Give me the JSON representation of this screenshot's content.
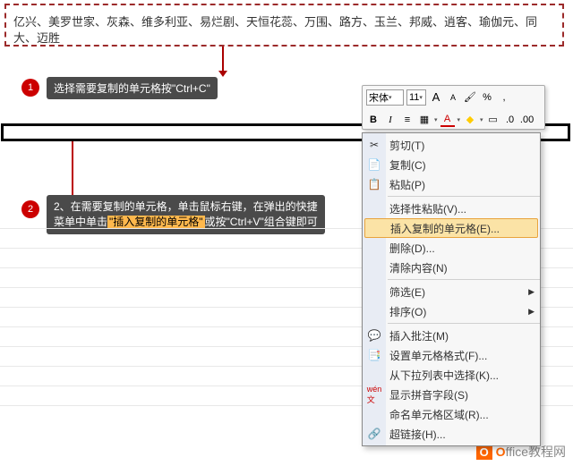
{
  "topBoxText": "亿兴、美罗世家、灰森、维多利亚、易烂剧、天恒花蕊、万围、路方、玉兰、邦威、逍客、瑜伽元、同大、迈胜",
  "step1": {
    "num": "1",
    "text": "选择需要复制的单元格按\"Ctrl+C\""
  },
  "step2": {
    "num": "2",
    "text_a": "2、在需要复制的单元格，单击鼠标右键，在弹出的快捷",
    "text_b": "菜单中单击",
    "hl": "\"插入复制的单元格\"",
    "text_c": "或按\"Ctrl+V\"组合键即可"
  },
  "miniToolbar": {
    "font": "宋体",
    "size": "11",
    "icons": {
      "growFont": "A",
      "shrinkFont": "A",
      "format": "🖌",
      "percent": "%",
      "bold": "B",
      "italic": "I",
      "align": "≡",
      "borders": "▦",
      "fontColor": "A",
      "fillColor": "◆",
      "decimals": "₀₀"
    }
  },
  "ctx": {
    "cut": "剪切(T)",
    "copy": "复制(C)",
    "paste": "粘贴(P)",
    "pasteSpecial": "选择性粘贴(V)...",
    "insertCopied": "插入复制的单元格(E)...",
    "delete": "删除(D)...",
    "clear": "清除内容(N)",
    "filter": "筛选(E)",
    "sort": "排序(O)",
    "insertComment": "插入批注(M)",
    "formatCells": "设置单元格格式(F)...",
    "pickList": "从下拉列表中选择(K)...",
    "pinyin": "显示拼音字段(S)",
    "nameRange": "命名单元格区域(R)...",
    "hyperlink": "超链接(H)..."
  },
  "watermark": {
    "brand": "Office教程网",
    "url": ""
  }
}
